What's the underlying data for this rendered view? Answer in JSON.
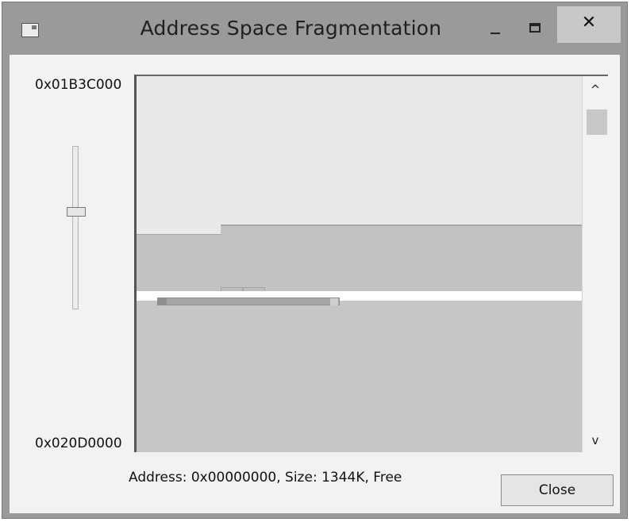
{
  "window": {
    "title": "Address Space Fragmentation",
    "minimize_glyph": "–",
    "close_glyph": "✕"
  },
  "address_range": {
    "top": "0x01B3C000",
    "bottom": "0x020D0000"
  },
  "scrollbar": {
    "up_glyph": "^",
    "down_glyph": "v"
  },
  "status": {
    "text": "Address: 0x00000000, Size: 1344K, Free"
  },
  "buttons": {
    "close_label": "Close"
  },
  "icons": {
    "app": "window-icon",
    "minimize": "minimize-icon",
    "maximize": "maximize-icon",
    "close": "close-icon"
  }
}
